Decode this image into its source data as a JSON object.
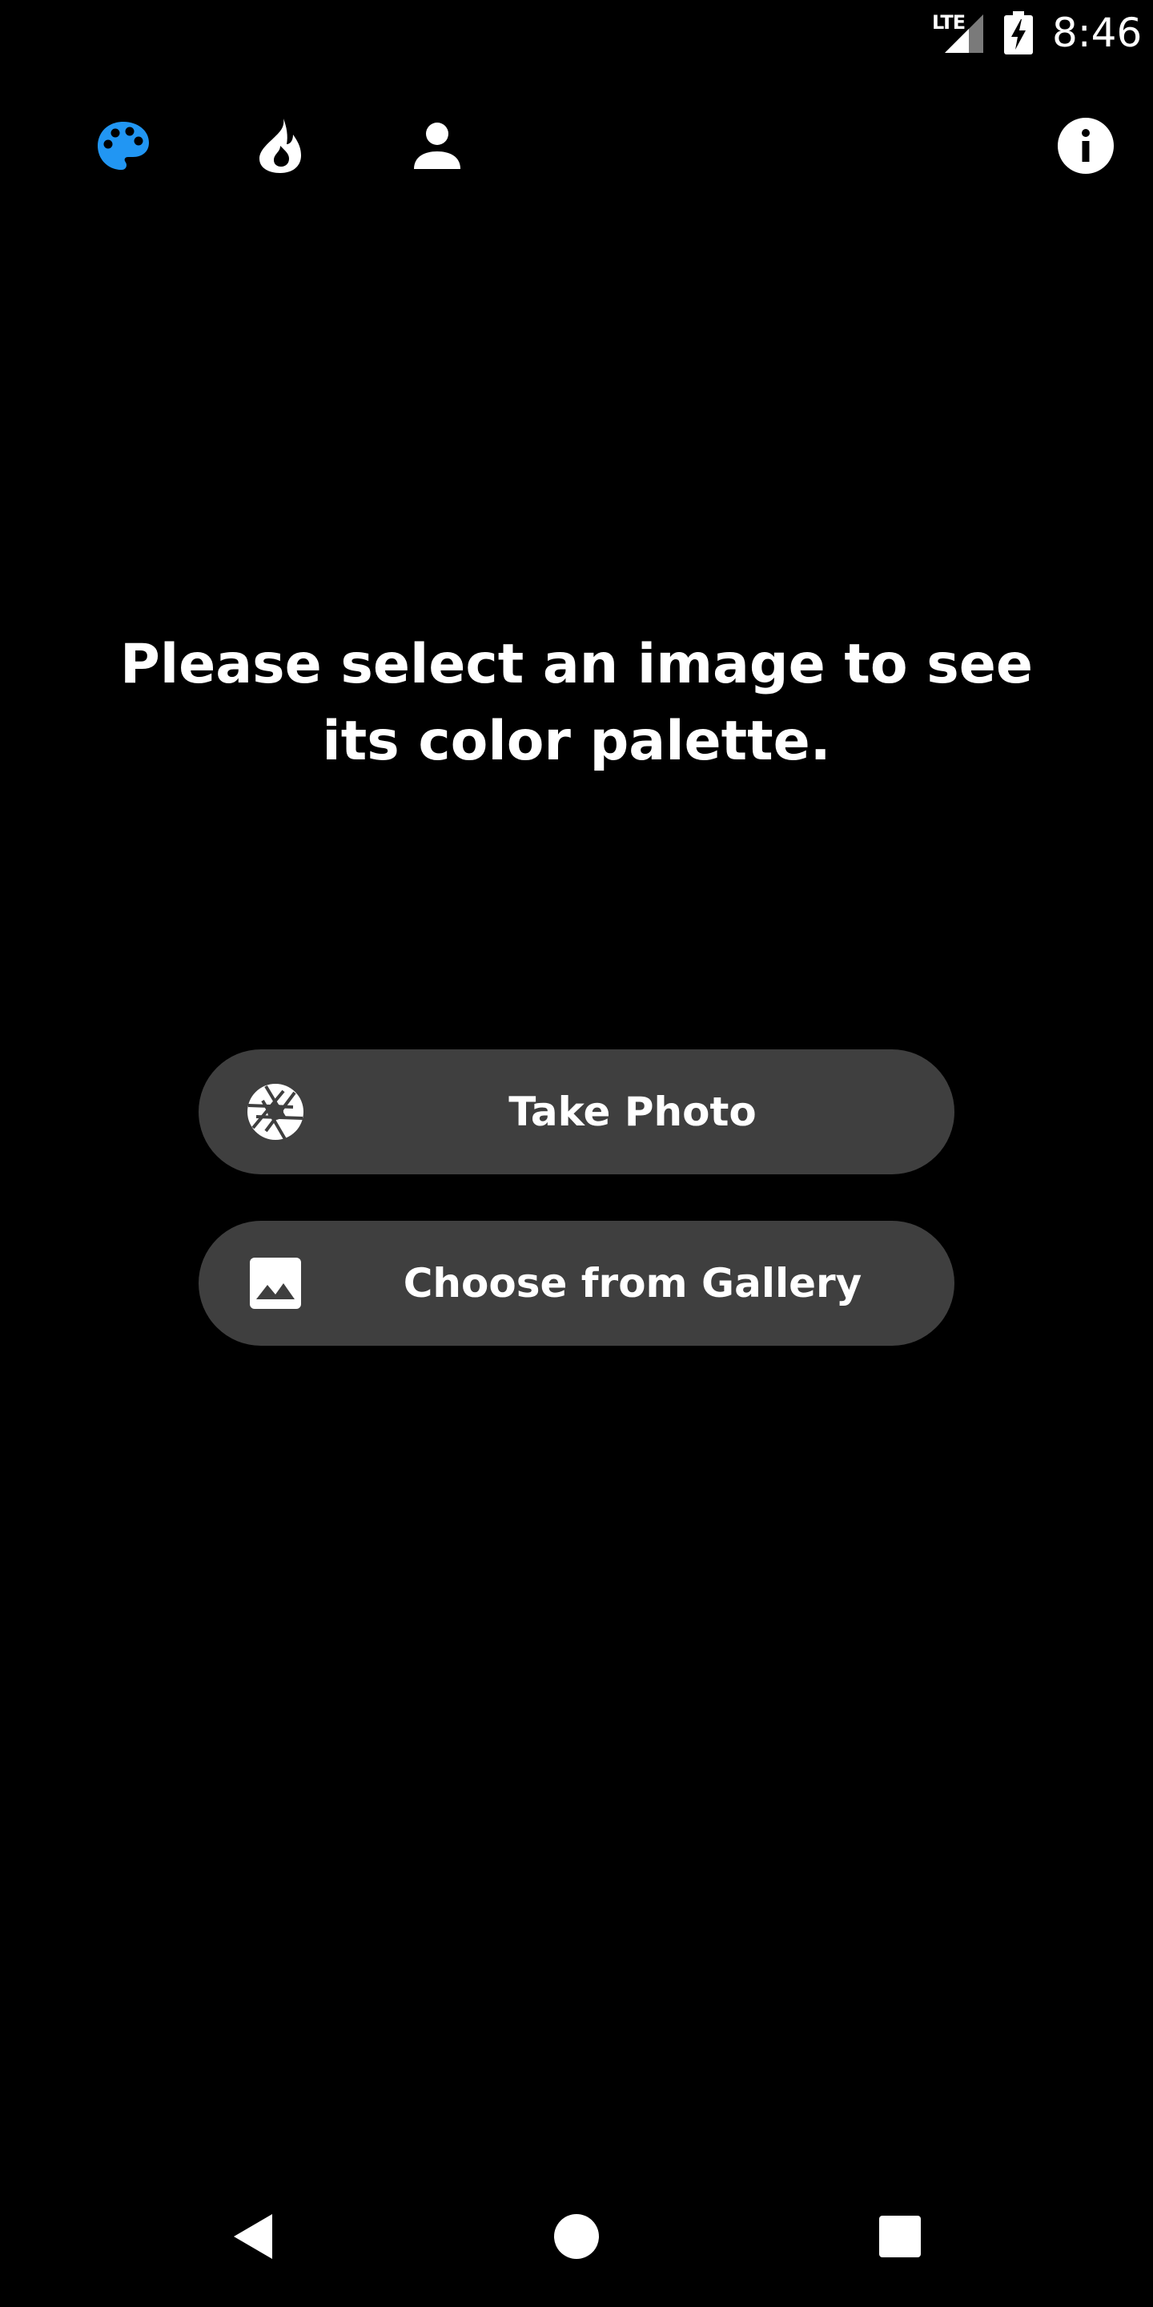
{
  "status_bar": {
    "network": "LTE",
    "time": "8:46"
  },
  "toolbar": {
    "icons": [
      "palette-icon",
      "trending-icon",
      "profile-icon",
      "info-icon"
    ],
    "active_color": "#2196f3"
  },
  "main": {
    "prompt": "Please select an image to see its color palette."
  },
  "actions": {
    "take_photo": {
      "label": "Take Photo",
      "icon": "camera-shutter-icon"
    },
    "gallery": {
      "label": "Choose from Gallery",
      "icon": "image-icon"
    }
  },
  "nav_bar": {
    "icons": [
      "back-icon",
      "home-icon",
      "recents-icon"
    ]
  },
  "colors": {
    "background": "#000000",
    "button": "#3f3f3f",
    "text": "#ffffff",
    "accent": "#2196f3"
  }
}
